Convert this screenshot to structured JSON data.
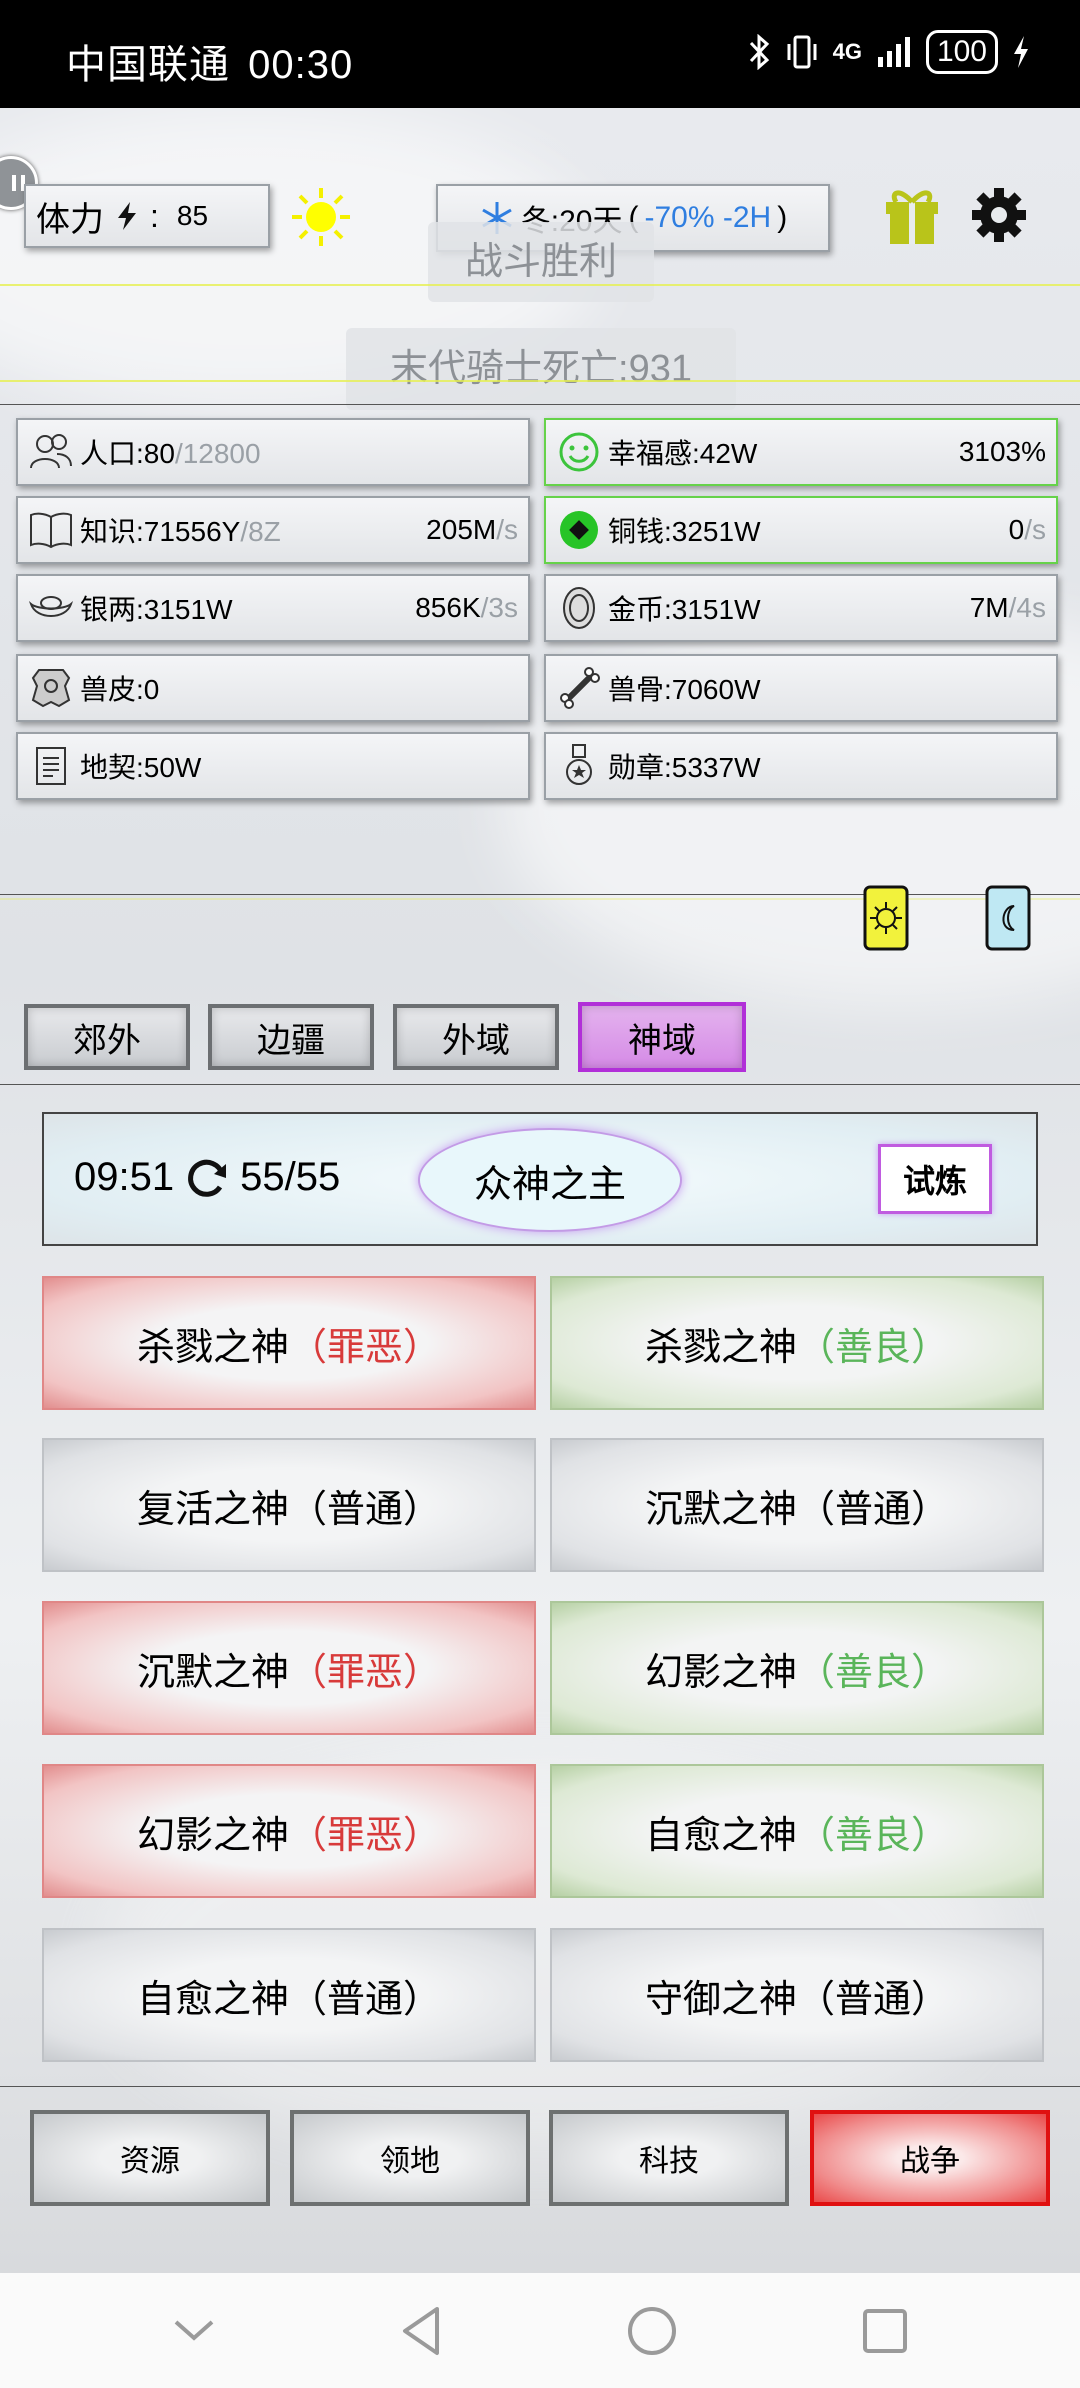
{
  "status_bar": {
    "carrier": "中国联通",
    "time": "00:30",
    "network": "4G",
    "battery": "100"
  },
  "top_bar": {
    "stamina_label": "体力",
    "stamina_sep": ":",
    "stamina_value": "85",
    "season_text": "冬:20天",
    "season_open": " (",
    "season_effect": "-70% -2H",
    "season_close": ")"
  },
  "toasts": {
    "battle_result": "战斗胜利",
    "kill_message": "末代骑士死亡:931"
  },
  "resources": [
    {
      "label": "人口:80",
      "sub": "/12800",
      "rate": "",
      "rate_unit": ""
    },
    {
      "label": "幸福感:42W",
      "sub": "",
      "rate": "3103%",
      "rate_unit": ""
    },
    {
      "label": "知识:71556Y",
      "sub": "/8Z",
      "rate": "205M",
      "rate_unit": "/s"
    },
    {
      "label": "铜钱:3251W",
      "sub": "",
      "rate": "0",
      "rate_unit": "/s"
    },
    {
      "label": "银两:3151W",
      "sub": "",
      "rate": "856K",
      "rate_unit": "/3s"
    },
    {
      "label": "金币:3151W",
      "sub": "",
      "rate": "7M",
      "rate_unit": "/4s"
    },
    {
      "label": "兽皮:0",
      "sub": "",
      "rate": "",
      "rate_unit": ""
    },
    {
      "label": "兽骨:7060W",
      "sub": "",
      "rate": "",
      "rate_unit": ""
    },
    {
      "label": "地契:50W",
      "sub": "",
      "rate": "",
      "rate_unit": ""
    },
    {
      "label": "勋章:5337W",
      "sub": "",
      "rate": "",
      "rate_unit": ""
    }
  ],
  "region_tabs": [
    "郊外",
    "边疆",
    "外域",
    "神域"
  ],
  "active_tab": "神域",
  "trial": {
    "timer": "09:51",
    "count": "55/55",
    "boss": "众神之主",
    "button": "试炼"
  },
  "gods": [
    {
      "name": "杀戮之神",
      "tag": "（罪恶）",
      "type": "evil"
    },
    {
      "name": "杀戮之神",
      "tag": "（善良）",
      "type": "good"
    },
    {
      "name": "复活之神",
      "tag": "（普通）",
      "type": "normal"
    },
    {
      "name": "沉默之神",
      "tag": "（普通）",
      "type": "normal"
    },
    {
      "name": "沉默之神",
      "tag": "（罪恶）",
      "type": "evil"
    },
    {
      "name": "幻影之神",
      "tag": "（善良）",
      "type": "good"
    },
    {
      "name": "幻影之神",
      "tag": "（罪恶）",
      "type": "evil"
    },
    {
      "name": "自愈之神",
      "tag": "（善良）",
      "type": "good"
    },
    {
      "name": "自愈之神",
      "tag": "（普通）",
      "type": "normal"
    },
    {
      "name": "守御之神",
      "tag": "（普通）",
      "type": "normal"
    }
  ],
  "bottom_nav": [
    "资源",
    "领地",
    "科技",
    "战争"
  ],
  "active_nav": "战争",
  "colors": {
    "evil": "#d83a3a",
    "good": "#5ab55a",
    "active_tab": "#b12fd8",
    "active_nav": "#e01010",
    "season_blue": "#2f7ee0"
  }
}
